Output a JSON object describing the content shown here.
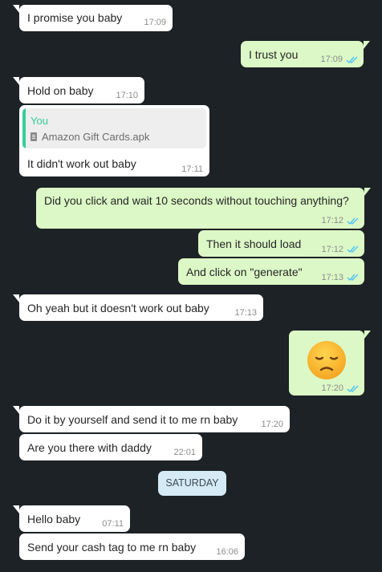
{
  "accent_colors": {
    "incoming": "#ffffff",
    "outgoing": "#dcf8c6",
    "background": "#1d2226",
    "read_ticks": "#4fc3f7"
  },
  "messages": [
    {
      "text": "I promise you baby",
      "time": "17:09"
    },
    {
      "text": "I trust you",
      "time": "17:09"
    },
    {
      "text": "Hold on baby",
      "time": "17:10"
    },
    {
      "quote_author": "You",
      "quote_file": "Amazon Gift Cards.apk",
      "text": "It didn't work out baby",
      "time": "17:11"
    },
    {
      "text": "Did you click and wait 10 seconds without touching anything?",
      "time": "17:12"
    },
    {
      "text": "Then it should load",
      "time": "17:12"
    },
    {
      "text": "And click on \"generate\"",
      "time": "17:13"
    },
    {
      "text": "Oh yeah but it doesn't work out baby",
      "time": "17:13"
    },
    {
      "emoji": "disappointed-face",
      "time": "17:20"
    },
    {
      "text": "Do it by yourself and send it to me rn baby",
      "time": "17:20"
    },
    {
      "text": "Are you there with daddy",
      "time": "22:01"
    },
    {
      "text": "Hello baby",
      "time": "07:11"
    },
    {
      "text": "Send your cash tag to me rn baby",
      "time": "16:06"
    }
  ],
  "date_divider": "SATURDAY"
}
